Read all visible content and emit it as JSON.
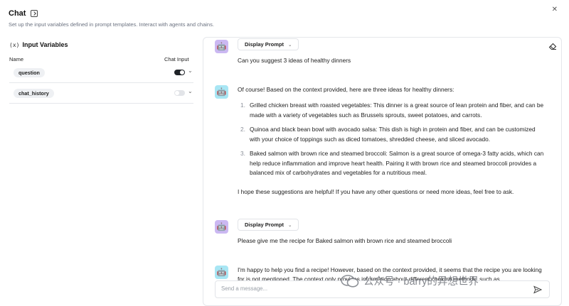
{
  "header": {
    "title": "Chat",
    "subtitle": "Set up the input variables defined in prompt templates. Interact with agents and chains."
  },
  "left_panel": {
    "section_title": "Input Variables",
    "section_icon": "variable-icon",
    "columns": {
      "name": "Name",
      "chat_input": "Chat Input"
    },
    "variables": [
      {
        "name": "question",
        "chat_input": true
      },
      {
        "name": "chat_history",
        "chat_input": false
      }
    ]
  },
  "chat": {
    "display_prompt_label": "Display Prompt",
    "messages": [
      {
        "role": "user",
        "avatar_icon": "robot-icon",
        "text": "Can you suggest 3 ideas of healthy dinners"
      },
      {
        "role": "bot",
        "avatar_icon": "bot-icon",
        "intro": "Of course! Based on the context provided, here are three ideas for healthy dinners:",
        "items": [
          "Grilled chicken breast with roasted vegetables: This dinner is a great source of lean protein and fiber, and can be made with a variety of vegetables such as Brussels sprouts, sweet potatoes, and carrots.",
          "Quinoa and black bean bowl with avocado salsa: This dish is high in protein and fiber, and can be customized with your choice of toppings such as diced tomatoes, shredded cheese, and sliced avocado.",
          "Baked salmon with brown rice and steamed broccoli: Salmon is a great source of omega-3 fatty acids, which can help reduce inflammation and improve heart health. Pairing it with brown rice and steamed broccoli provides a balanced mix of carbohydrates and vegetables for a nutritious meal."
        ],
        "outro": "I hope these suggestions are helpful! If you have any other questions or need more ideas, feel free to ask."
      },
      {
        "role": "user",
        "avatar_icon": "robot-icon",
        "text": "Please give me the recipe for Baked salmon with brown rice and steamed broccoli"
      },
      {
        "role": "bot",
        "avatar_icon": "bot-icon",
        "text": "I'm happy to help you find a recipe! However, based on the context provided, it seems that the recipe you are looking for is not mentioned. The context only provides information about different cooking methods, such as"
      }
    ],
    "input_placeholder": "Send a message..."
  },
  "watermark": {
    "text": "公众号 · barry的异想世界"
  },
  "colors": {
    "user_avatar": "#cbb8f2",
    "bot_avatar": "#a8e6f4",
    "toggle_on": "#1f2328",
    "toggle_off": "#e2e4e8"
  }
}
